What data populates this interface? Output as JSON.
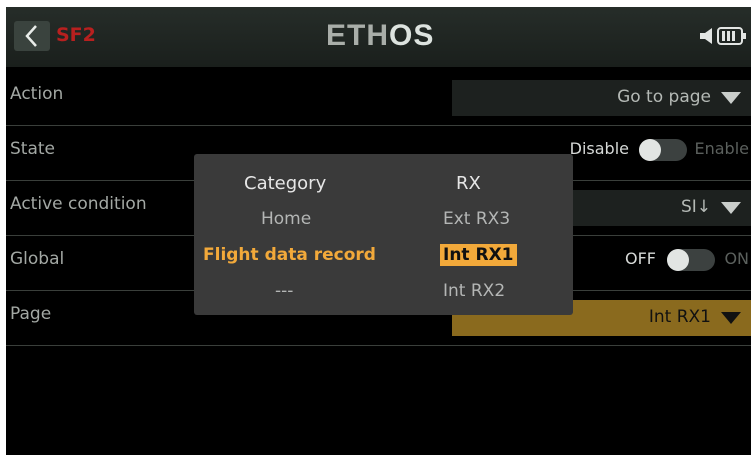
{
  "header": {
    "title": "SF2",
    "logo_main": "ETH",
    "logo_os": "OS",
    "back_icon": "chevron-left-icon",
    "battery_icon": "battery-icon"
  },
  "rows": {
    "action": {
      "label": "Action",
      "value": "Go to page"
    },
    "state": {
      "label": "State",
      "left": "Disable",
      "right": "Enable"
    },
    "active_condition": {
      "label": "Active condition",
      "value": "SI↓"
    },
    "global": {
      "label": "Global",
      "left": "OFF",
      "right": "ON"
    },
    "page": {
      "label": "Page",
      "value": "Int RX1"
    }
  },
  "popup": {
    "col1_header": "Category",
    "col2_header": "RX",
    "col1_items": [
      "Home",
      "Flight data record",
      "---"
    ],
    "col2_items": [
      "Ext RX3",
      "Int RX1",
      "Int RX2"
    ]
  },
  "colors": {
    "accent": "#f2a93a",
    "title_red": "#b8201f",
    "selected_row": "#8a6a1e"
  }
}
